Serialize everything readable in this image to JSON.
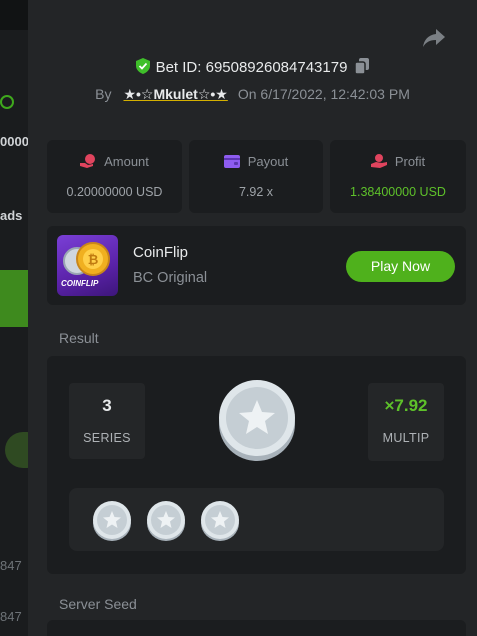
{
  "background": {
    "texts": [
      "0000",
      "ads",
      "847",
      "847"
    ]
  },
  "modal": {
    "bet_id_label": "Bet ID: 69508926084743179",
    "by_label": "By",
    "username": "★•☆Mkulet☆•★",
    "on_label": "On",
    "timestamp": "6/17/2022, 12:42:03 PM",
    "stats": [
      {
        "label": "Amount",
        "value": "0.20000000 USD",
        "icon": "coins-icon"
      },
      {
        "label": "Payout",
        "value": "7.92 x",
        "icon": "wallet-icon"
      },
      {
        "label": "Profit",
        "value": "1.38400000 USD",
        "icon": "profit-icon"
      }
    ],
    "game": {
      "name": "CoinFlip",
      "subtitle": "BC Original",
      "thumb_label": "COINFLIP",
      "play_label": "Play Now"
    },
    "result": {
      "section_label": "Result",
      "series_value": "3",
      "series_label": "SERIES",
      "multiplier_value": "×7.92",
      "multiplier_label": "MULTIP"
    },
    "server_seed_label": "Server Seed"
  },
  "colors": {
    "accent_green": "#4fb11c",
    "profit_green": "#5ec12a",
    "amount_icon": "#e0445e",
    "payout_icon": "#8e5cf0",
    "profit_icon": "#e0445e",
    "verified_shield": "#3fbf2a"
  }
}
